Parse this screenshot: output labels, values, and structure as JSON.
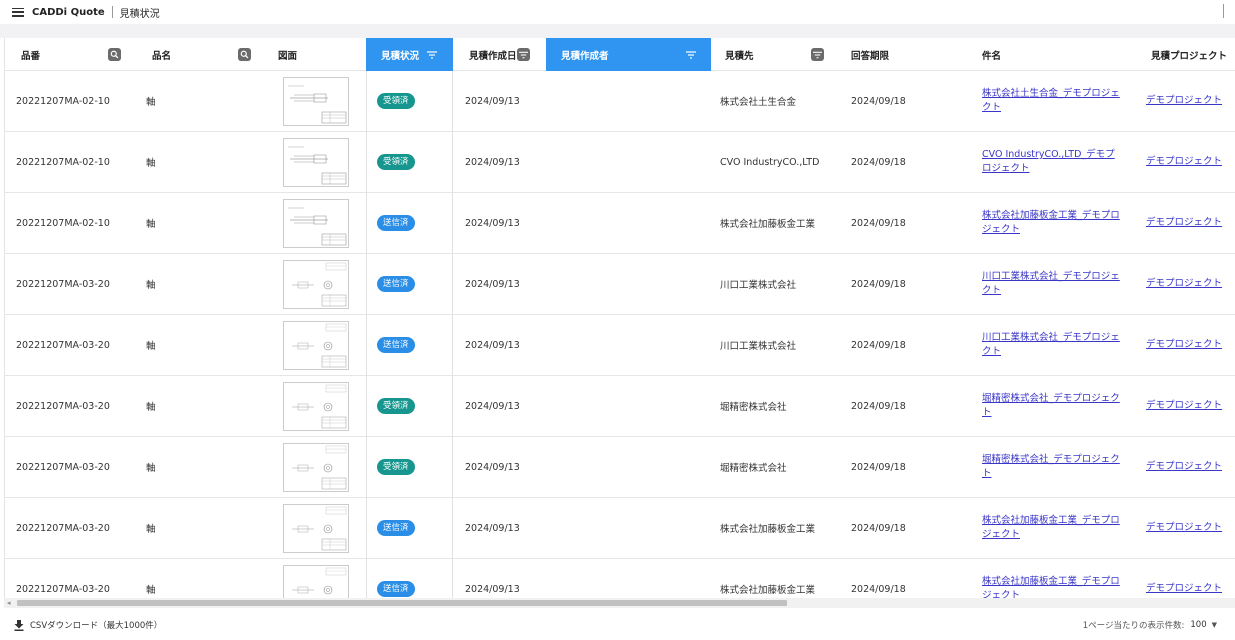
{
  "header": {
    "app_title": "CADDi Quote",
    "page_title": "見積状況"
  },
  "columns": {
    "part_no": "品番",
    "part_name": "品名",
    "drawing": "図面",
    "status": "見積状況",
    "created_date": "見積作成日",
    "creator": "見積作成者",
    "supplier": "見積先",
    "due_date": "回答期限",
    "subject": "件名",
    "project": "見積プロジェクト"
  },
  "rows": [
    {
      "part_no": "20221207MA-02-10",
      "part_name": "軸",
      "status": "受領済",
      "status_kind": "received",
      "created_date": "2024/09/13",
      "creator": "",
      "supplier": "株式会社土生合金",
      "due_date": "2024/09/18",
      "subject": "株式会社土生合金_デモプロジェクト",
      "project": "デモプロジェクト"
    },
    {
      "part_no": "20221207MA-02-10",
      "part_name": "軸",
      "status": "受領済",
      "status_kind": "received",
      "created_date": "2024/09/13",
      "creator": "",
      "supplier": "CVO IndustryCO.,LTD",
      "due_date": "2024/09/18",
      "subject": "CVO IndustryCO.,LTD_デモプロジェクト",
      "project": "デモプロジェクト"
    },
    {
      "part_no": "20221207MA-02-10",
      "part_name": "軸",
      "status": "送信済",
      "status_kind": "sent",
      "created_date": "2024/09/13",
      "creator": "",
      "supplier": "株式会社加藤板金工業",
      "due_date": "2024/09/18",
      "subject": "株式会社加藤板金工業_デモプロジェクト",
      "project": "デモプロジェクト"
    },
    {
      "part_no": "20221207MA-03-20",
      "part_name": "軸",
      "status": "送信済",
      "status_kind": "sent",
      "created_date": "2024/09/13",
      "creator": "",
      "supplier": "川口工業株式会社",
      "due_date": "2024/09/18",
      "subject": "川口工業株式会社_デモプロジェクト",
      "project": "デモプロジェクト"
    },
    {
      "part_no": "20221207MA-03-20",
      "part_name": "軸",
      "status": "送信済",
      "status_kind": "sent",
      "created_date": "2024/09/13",
      "creator": "",
      "supplier": "川口工業株式会社",
      "due_date": "2024/09/18",
      "subject": "川口工業株式会社_デモプロジェクト",
      "project": "デモプロジェクト"
    },
    {
      "part_no": "20221207MA-03-20",
      "part_name": "軸",
      "status": "受領済",
      "status_kind": "received",
      "created_date": "2024/09/13",
      "creator": "",
      "supplier": "堀精密株式会社",
      "due_date": "2024/09/18",
      "subject": "堀精密株式会社_デモプロジェクト",
      "project": "デモプロジェクト"
    },
    {
      "part_no": "20221207MA-03-20",
      "part_name": "軸",
      "status": "受領済",
      "status_kind": "received",
      "created_date": "2024/09/13",
      "creator": "",
      "supplier": "堀精密株式会社",
      "due_date": "2024/09/18",
      "subject": "堀精密株式会社_デモプロジェクト",
      "project": "デモプロジェクト"
    },
    {
      "part_no": "20221207MA-03-20",
      "part_name": "軸",
      "status": "送信済",
      "status_kind": "sent",
      "created_date": "2024/09/13",
      "creator": "",
      "supplier": "株式会社加藤板金工業",
      "due_date": "2024/09/18",
      "subject": "株式会社加藤板金工業_デモプロジェクト",
      "project": "デモプロジェクト"
    },
    {
      "part_no": "20221207MA-03-20",
      "part_name": "軸",
      "status": "送信済",
      "status_kind": "sent",
      "created_date": "2024/09/13",
      "creator": "",
      "supplier": "株式会社加藤板金工業",
      "due_date": "2024/09/18",
      "subject": "株式会社加藤板金工業_デモプロジェクト",
      "project": "デモプロジェクト"
    }
  ],
  "footer": {
    "csv_label": "CSVダウンロード（最大1000件）",
    "per_page_label": "1ページ当たりの表示件数:",
    "per_page_value": "100"
  },
  "colors": {
    "accent": "#2f95f0",
    "received_badge": "#16968e",
    "sent_badge": "#2a8ee6",
    "link": "#3a36c8"
  }
}
